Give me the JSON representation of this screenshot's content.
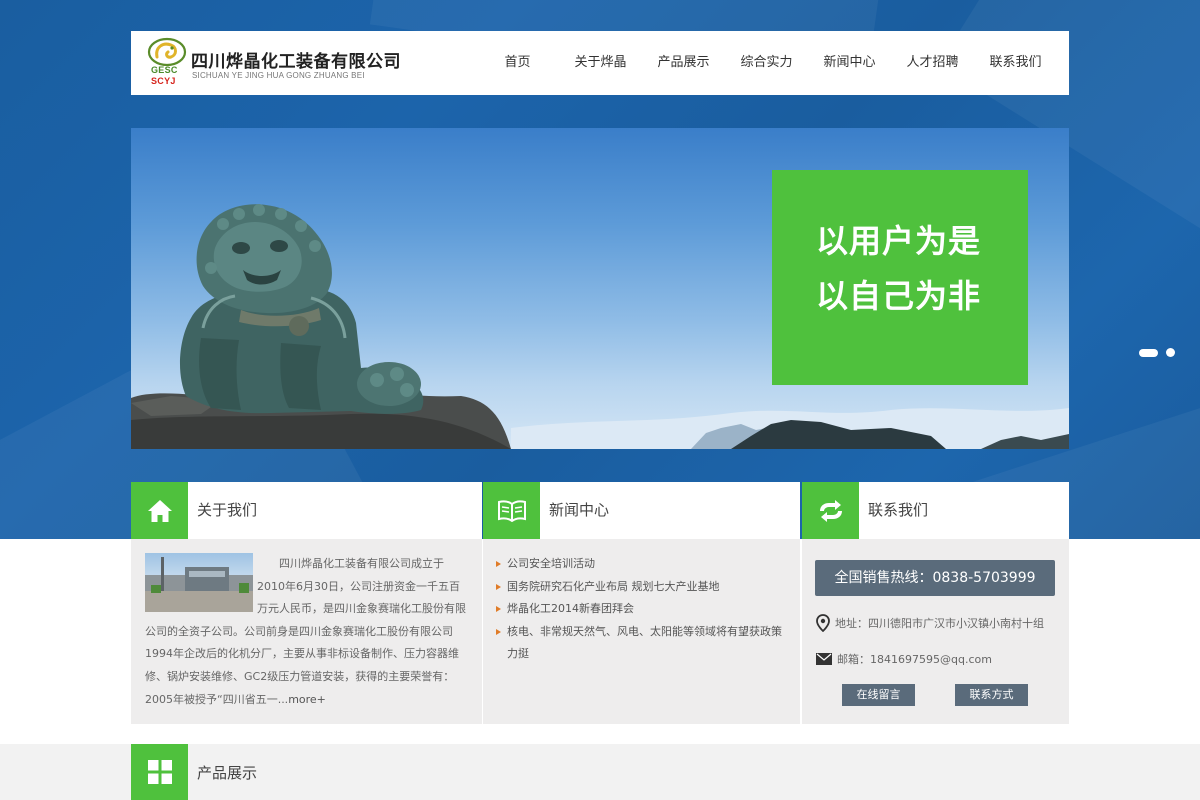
{
  "header": {
    "logo": {
      "top_text": "GESC",
      "bottom_text": "SCYJ"
    },
    "company_name_cn": "四川烨晶化工装备有限公司",
    "company_name_en": "SICHUAN YE JING HUA GONG ZHUANG BEI"
  },
  "nav": {
    "items": [
      {
        "label": "首页"
      },
      {
        "label": "关于烨晶"
      },
      {
        "label": "产品展示"
      },
      {
        "label": "综合实力"
      },
      {
        "label": "新闻中心"
      },
      {
        "label": "人才招聘"
      },
      {
        "label": "联系我们"
      }
    ]
  },
  "banner": {
    "slogan_line1": "以用户为是",
    "slogan_line2": "以自己为非",
    "slide_count": 2,
    "active_slide": 1
  },
  "about": {
    "title": "关于我们",
    "text": "四川烨晶化工装备有限公司成立于2010年6月30日，公司注册资金一千五百万元人民币，是四川金象赛瑞化工股份有限公司的全资子公司。公司前身是四川金象赛瑞化工股份有限公司1994年企改后的化机分厂，主要从事非标设备制作、压力容器维修、锅炉安装维修、GC2级压力管道安装，获得的主要荣誉有：2005年被授予“四川省五一...",
    "more_label": "more+"
  },
  "news": {
    "title": "新闻中心",
    "items": [
      {
        "text": "公司安全培训活动"
      },
      {
        "text": "国务院研究石化产业布局 规划七大产业基地"
      },
      {
        "text": "烨晶化工2014新春团拜会"
      },
      {
        "text": "核电、非常规天然气、风电、太阳能等领域将有望获政策力挺"
      }
    ]
  },
  "contact": {
    "title": "联系我们",
    "hotline": "全国销售热线：0838-5703999",
    "address": "地址：四川德阳市广汉市小汉镇小南村十组",
    "email": "邮箱：1841697595@qq.com",
    "message_button": "在线留言",
    "contact_button": "联系方式"
  },
  "products": {
    "title": "产品展示"
  },
  "colors": {
    "accent_green": "#4fc13d",
    "page_blue": "#1c62a8",
    "button_slate": "#5a6b7b",
    "bullet_orange": "#e07c28"
  },
  "icons": {
    "about": "home-icon",
    "news": "book-icon",
    "contact": "exchange-arrows-icon",
    "products": "grid-icon",
    "address": "location-pin-icon",
    "email": "envelope-icon"
  }
}
